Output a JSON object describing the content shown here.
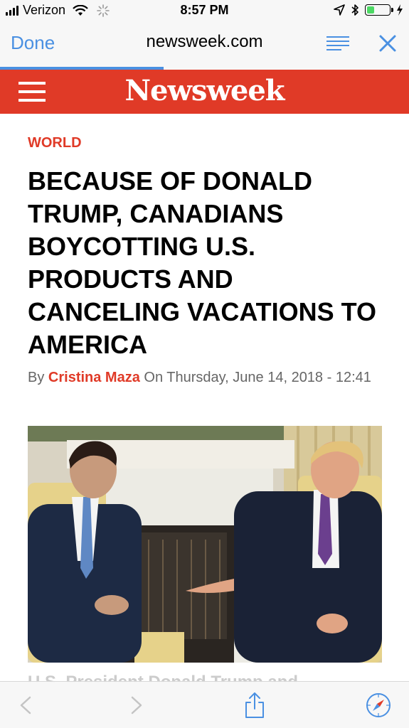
{
  "status_bar": {
    "carrier": "Verizon",
    "time": "8:57 PM",
    "battery_level": 0.35,
    "battery_color": "#4cd964"
  },
  "browser": {
    "done_label": "Done",
    "url": "newsweek.com",
    "load_progress": 0.4,
    "accent_color": "#4a90e2",
    "icons": [
      "reader-view-icon",
      "close-icon"
    ]
  },
  "site": {
    "logo": "Newsweek",
    "brand_color": "#e03a27",
    "menu_icon": "hamburger-menu-icon"
  },
  "article": {
    "section": "WORLD",
    "headline": "BECAUSE OF DONALD TRUMP, CANADIANS BOYCOTTING U.S. PRODUCTS AND CANCELING VACATIONS TO AMERICA",
    "byline_by": "By",
    "author": "Cristina Maza",
    "byline_on": "On Thursday, June 14, 2018 - 12:41",
    "next_line": "U.S. President Donald Trump and"
  },
  "toolbar": {
    "icons": [
      "back-icon",
      "forward-icon",
      "share-icon",
      "compass-icon"
    ]
  }
}
